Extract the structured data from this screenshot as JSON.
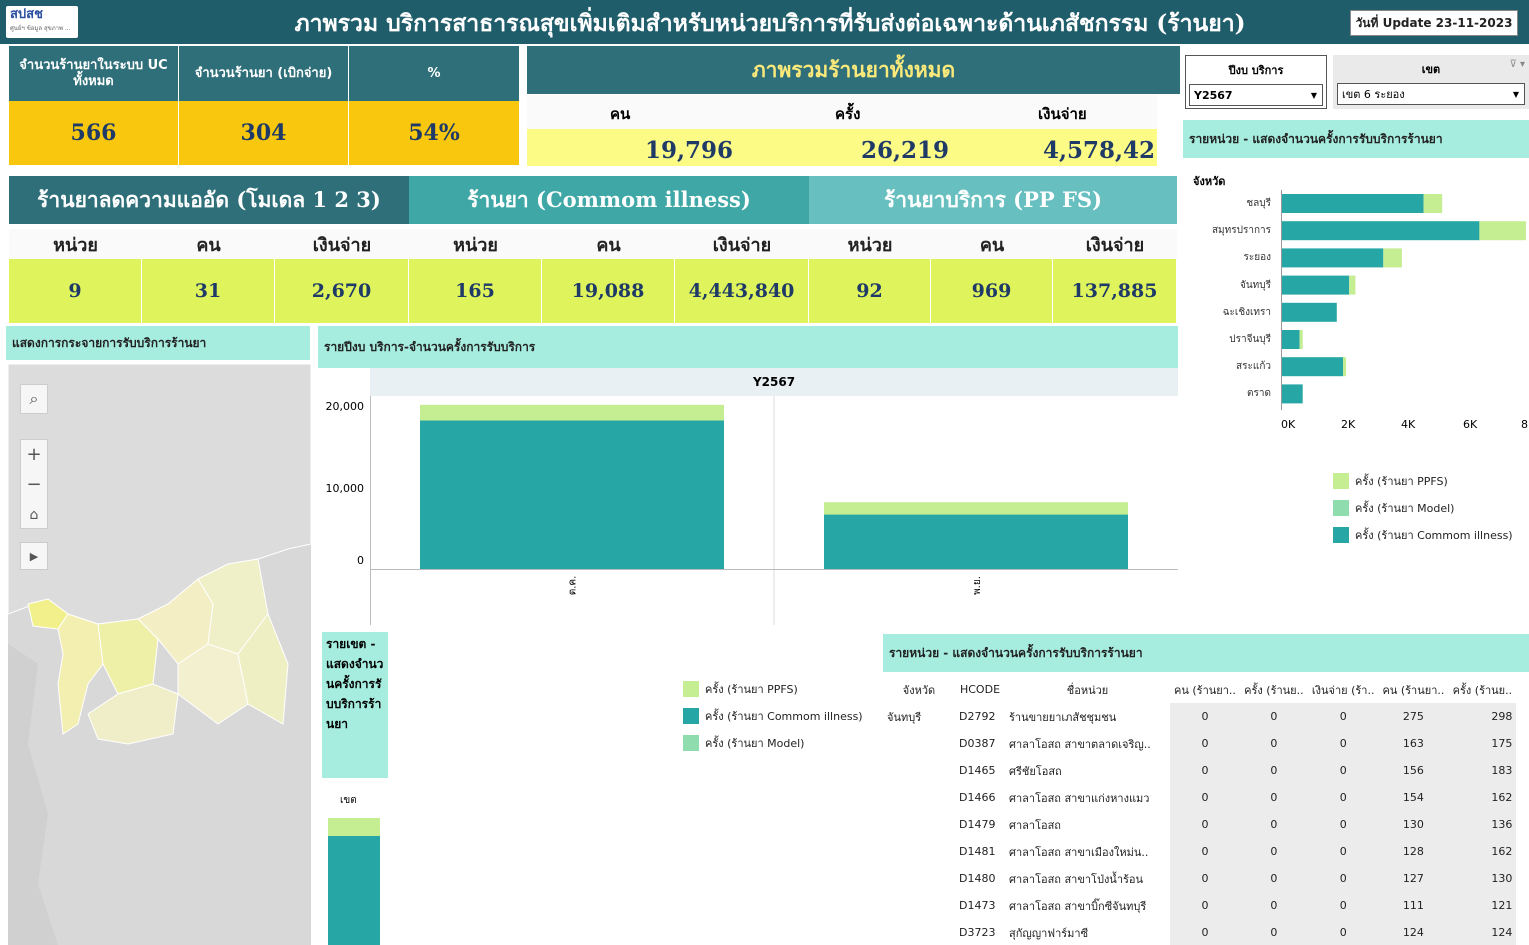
{
  "header": {
    "logo_text": "สปสช",
    "logo_sub": "ศูนย์ฯ ข้อมูล สุขภาพ ...",
    "title": "ภาพรวม บริการสาธารณสุขเพิ่มเติมสำหรับหน่วยบริการที่รับส่งต่อเฉพาะด้านเภสัชกรรม (ร้านยา)",
    "update": "วันที่ Update 23-11-2023"
  },
  "kpi_uc": {
    "h1": "จำนวนร้านยาในระบบ UC ทั้งหมด",
    "h2": "จำนวนร้านยา (เบิกจ่าย)",
    "h3": "%",
    "v1": "566",
    "v2": "304",
    "v3": "54%"
  },
  "overview": {
    "title": "ภาพรวมร้านยาทั้งหมด",
    "c1": "คน",
    "c2": "ครั้ง",
    "c3": "เงินจ่าย",
    "v1": "19,796",
    "v2": "26,219",
    "v3": "4,578,42"
  },
  "filters": {
    "year_label": "ปีงบ บริการ",
    "year_value": "Y2567",
    "zone_label": "เขต",
    "zone_value": "เขต 6 ระยอง"
  },
  "groups": [
    {
      "title": "ร้านยาลดความแออัด (โมเดล 1 2 3)",
      "h1": "หน่วย",
      "h2": "คน",
      "h3": "เงินจ่าย",
      "v1": "9",
      "v2": "31",
      "v3": "2,670"
    },
    {
      "title": "ร้านยา (Commom illness)",
      "h1": "หน่วย",
      "h2": "คน",
      "h3": "เงินจ่าย",
      "v1": "165",
      "v2": "19,088",
      "v3": "4,443,840"
    },
    {
      "title": "ร้านยาบริการ  (PP FS)",
      "h1": "หน่วย",
      "h2": "คน",
      "h3": "เงินจ่าย",
      "v1": "92",
      "v2": "969",
      "v3": "137,885"
    }
  ],
  "map_panel": {
    "title": "แสดงการกระจายการรับบริการร้านยา"
  },
  "year_chart": {
    "title": "รายปีงบ บริการ-จำนวนครั้งการรับบริการ",
    "year_header": "Y2567",
    "ticks": [
      "20,000",
      "10,000",
      "0"
    ],
    "cat1": "ต.ค.",
    "cat2": "พ.ย."
  },
  "province_panel": {
    "title": "รายหน่วย - แสดงจำนวนครั้งการรับบริการร้านยา",
    "col_label": "จังหวัด",
    "ticks": [
      "0K",
      "2K",
      "4K",
      "6K",
      "8"
    ]
  },
  "legend": {
    "ppfs": "ครั้ง (ร้านยา PPFS)",
    "model": "ครั้ง (ร้านยา Model)",
    "common": "ครั้ง (ร้านยา Commom illness)"
  },
  "zone_panel": {
    "title": "รายเขต - แสดงจำนวนครั้งการรับบริการร้านยา",
    "col_label": "เขต"
  },
  "unit_table": {
    "title": "รายหน่วย - แสดงจำนวนครั้งการรับบริการร้านยา",
    "headers": [
      "จังหวัด",
      "HCODE",
      "ชื่อหน่วย",
      "คน (ร้านยา..",
      "ครั้ง (ร้านย..",
      "เงินจ่าย (ร้า..",
      "คน (ร้านยา..",
      "ครั้ง (ร้านย.."
    ],
    "province": "จันทบุรี",
    "rows": [
      {
        "hcode": "D2792",
        "name": "ร้านขายยาเภสัชชุมชน",
        "c1": "0",
        "c2": "0",
        "c3": "0",
        "c4": "275",
        "c5": "298"
      },
      {
        "hcode": "D0387",
        "name": "ศาลาโอสถ สาขาตลาดเจริญ..",
        "c1": "0",
        "c2": "0",
        "c3": "0",
        "c4": "163",
        "c5": "175"
      },
      {
        "hcode": "D1465",
        "name": "ศรีชัยโอสถ",
        "c1": "0",
        "c2": "0",
        "c3": "0",
        "c4": "156",
        "c5": "183"
      },
      {
        "hcode": "D1466",
        "name": "ศาลาโอสถ สาขาแก่งหางแมว",
        "c1": "0",
        "c2": "0",
        "c3": "0",
        "c4": "154",
        "c5": "162"
      },
      {
        "hcode": "D1479",
        "name": "ศาลาโอสถ",
        "c1": "0",
        "c2": "0",
        "c3": "0",
        "c4": "130",
        "c5": "136"
      },
      {
        "hcode": "D1481",
        "name": "ศาลาโอสถ สาขาเมืองใหม่น..",
        "c1": "0",
        "c2": "0",
        "c3": "0",
        "c4": "128",
        "c5": "162"
      },
      {
        "hcode": "D1480",
        "name": "ศาลาโอสถ สาขาโป่งน้ำร้อน",
        "c1": "0",
        "c2": "0",
        "c3": "0",
        "c4": "127",
        "c5": "130"
      },
      {
        "hcode": "D1473",
        "name": "ศาลาโอสถ สาขาบิ๊กซีจันทบุรี",
        "c1": "0",
        "c2": "0",
        "c3": "0",
        "c4": "111",
        "c5": "121"
      },
      {
        "hcode": "D3723",
        "name": "สุกัญญาฟาร์มาซี",
        "c1": "0",
        "c2": "0",
        "c3": "0",
        "c4": "124",
        "c5": "124"
      }
    ]
  },
  "chart_data": [
    {
      "type": "bar",
      "title": "รายปีงบ บริการ-จำนวนครั้งการรับบริการ",
      "categories": [
        "ต.ค.",
        "พ.ย."
      ],
      "series": [
        {
          "name": "ครั้ง (ร้านยา Commom illness)",
          "values": [
            18000,
            6600
          ]
        },
        {
          "name": "ครั้ง (ร้านยา PPFS)",
          "values": [
            1900,
            1500
          ]
        }
      ],
      "ylim": [
        0,
        20000
      ],
      "colors": {
        "common": "#26a7a6",
        "ppfs": "#c5ed91"
      }
    },
    {
      "type": "bar",
      "orientation": "horizontal",
      "title": "รายหน่วย - แสดงจำนวนครั้งการรับบริการร้านยา",
      "categories": [
        "ชลบุรี",
        "สมุทรปราการ",
        "ระยอง",
        "จันทบุรี",
        "ฉะเชิงเทรา",
        "ปราจีนบุรี",
        "สระแก้ว",
        "ตราด"
      ],
      "series": [
        {
          "name": "ครั้ง (ร้านยา Commom illness)",
          "values": [
            4600,
            6400,
            3300,
            2200,
            1800,
            600,
            2000,
            700
          ]
        },
        {
          "name": "ครั้ง (ร้านยา Model)",
          "values": [
            0,
            0,
            0,
            0,
            0,
            0,
            0,
            0
          ]
        },
        {
          "name": "ครั้ง (ร้านยา PPFS)",
          "values": [
            600,
            1500,
            600,
            200,
            0,
            100,
            100,
            0
          ]
        }
      ],
      "xlim": [
        0,
        8000
      ]
    }
  ]
}
